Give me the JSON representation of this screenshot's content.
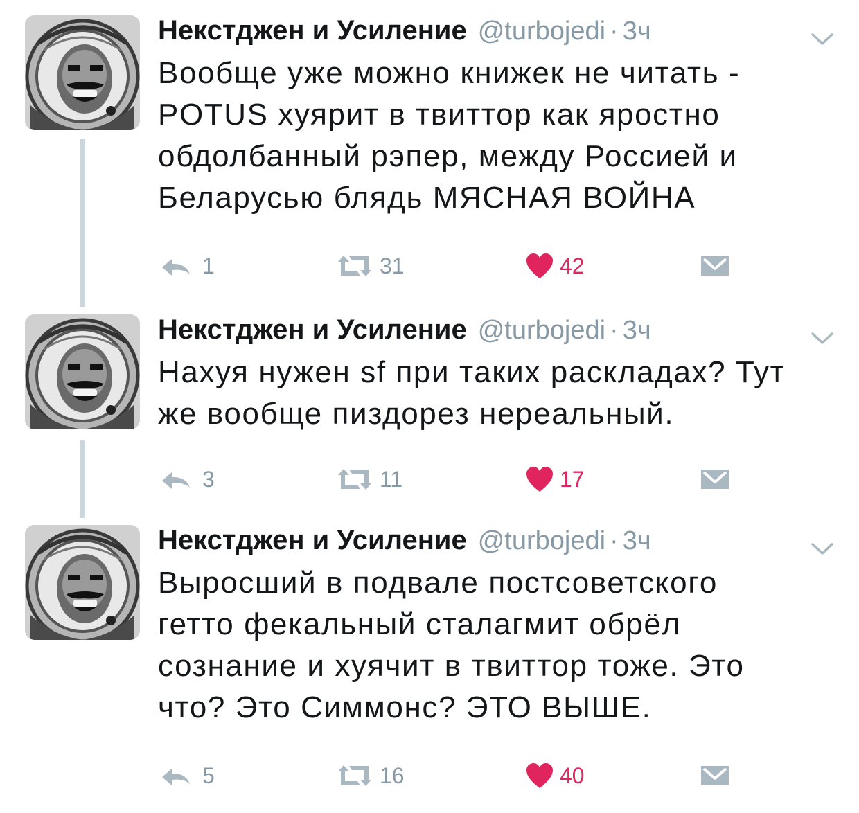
{
  "colors": {
    "text": "#14171a",
    "muted": "#8899a6",
    "like": "#e0245e",
    "thread_line": "#ccd6dd"
  },
  "icons": {
    "avatar": "astronaut-avatar",
    "reply": "reply-icon",
    "retweet": "retweet-icon",
    "like": "heart-icon",
    "dm": "direct-message-icon",
    "menu": "chevron-down-icon"
  },
  "tweets": [
    {
      "name": "Некстджен и Усиление",
      "handle": "@turbojedi",
      "separator": "·",
      "time": "3ч",
      "lines": [
        "Вообще уже можно книжек не читать -",
        "POTUS хуярит в твиттор как яростно",
        "обдолбанный рэпер, между Россией и",
        "Беларусью блядь МЯСНАЯ ВОЙНА"
      ],
      "replies": "1",
      "retweets": "31",
      "likes": "42",
      "liked": true
    },
    {
      "name": "Некстджен и Усиление",
      "handle": "@turbojedi",
      "separator": "·",
      "time": "3ч",
      "lines": [
        "Нахуя нужен sf при таких раскладах? Тут",
        "же вообще пиздорез нереальный."
      ],
      "replies": "3",
      "retweets": "11",
      "likes": "17",
      "liked": true
    },
    {
      "name": "Некстджен и Усиление",
      "handle": "@turbojedi",
      "separator": "·",
      "time": "3ч",
      "lines": [
        "Выросший в подвале постсоветского",
        "гетто фекальный сталагмит обрёл",
        "сознание и хуячит в твиттор тоже. Это",
        "что? Это Симмонс? ЭТО ВЫШЕ."
      ],
      "replies": "5",
      "retweets": "16",
      "likes": "40",
      "liked": true
    }
  ]
}
